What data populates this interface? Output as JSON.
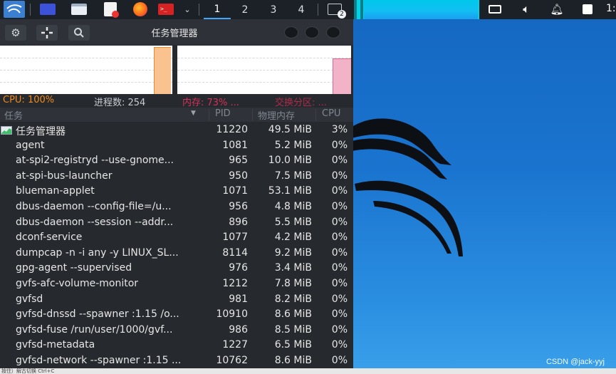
{
  "taskbar": {
    "workspaces": [
      "1",
      "2",
      "3",
      "4"
    ],
    "active_workspace": "1",
    "notification_count": "2",
    "clock": "1:",
    "icons": [
      "kali-menu-icon",
      "show-desktop-icon",
      "file-manager-icon",
      "text-editor-icon",
      "firefox-icon",
      "terminal-icon"
    ]
  },
  "window": {
    "title": "任务管理器"
  },
  "stats": {
    "cpu": "CPU: 100%",
    "processes": "进程数: 254",
    "memory": "内存: 73% ...",
    "swap": "交换分区: ..."
  },
  "columns": {
    "task": "任务",
    "pid": "PID",
    "memory": "物理内存",
    "cpu": "CPU"
  },
  "processes": [
    {
      "name": "任务管理器",
      "pid": "11220",
      "mem": "49.5 MiB",
      "cpu": "3%"
    },
    {
      "name": "agent",
      "pid": "1081",
      "mem": "5.2 MiB",
      "cpu": "0%"
    },
    {
      "name": "at-spi2-registryd --use-gnome...",
      "pid": "965",
      "mem": "10.0 MiB",
      "cpu": "0%"
    },
    {
      "name": "at-spi-bus-launcher",
      "pid": "950",
      "mem": "7.5 MiB",
      "cpu": "0%"
    },
    {
      "name": "blueman-applet",
      "pid": "1071",
      "mem": "53.1 MiB",
      "cpu": "0%"
    },
    {
      "name": "dbus-daemon --config-file=/u...",
      "pid": "956",
      "mem": "4.8 MiB",
      "cpu": "0%"
    },
    {
      "name": "dbus-daemon --session --addr...",
      "pid": "896",
      "mem": "5.5 MiB",
      "cpu": "0%"
    },
    {
      "name": "dconf-service",
      "pid": "1077",
      "mem": "4.2 MiB",
      "cpu": "0%"
    },
    {
      "name": "dumpcap -n -i any -y LINUX_SL...",
      "pid": "8114",
      "mem": "9.2 MiB",
      "cpu": "0%"
    },
    {
      "name": "gpg-agent --supervised",
      "pid": "976",
      "mem": "3.4 MiB",
      "cpu": "0%"
    },
    {
      "name": "gvfs-afc-volume-monitor",
      "pid": "1212",
      "mem": "7.8 MiB",
      "cpu": "0%"
    },
    {
      "name": "gvfsd",
      "pid": "981",
      "mem": "8.2 MiB",
      "cpu": "0%"
    },
    {
      "name": "gvfsd-dnssd --spawner :1.15 /o...",
      "pid": "10910",
      "mem": "8.6 MiB",
      "cpu": "0%"
    },
    {
      "name": "gvfsd-fuse /run/user/1000/gvf...",
      "pid": "986",
      "mem": "8.5 MiB",
      "cpu": "0%"
    },
    {
      "name": "gvfsd-metadata",
      "pid": "1227",
      "mem": "6.5 MiB",
      "cpu": "0%"
    },
    {
      "name": "gvfsd-network --spawner :1.15 ...",
      "pid": "10762",
      "mem": "8.6 MiB",
      "cpu": "0%"
    }
  ],
  "desktop": {
    "watermark": "CSDN @jack-yyj",
    "status_hint": "按住）解古切换 Ctrl+C"
  },
  "colors": {
    "cpu_stat": "#f08a1c",
    "mem_stat": "#d6305a",
    "swap_stat": "#b02a4c",
    "taskbar_cpu_graph": "#00d2e8"
  }
}
